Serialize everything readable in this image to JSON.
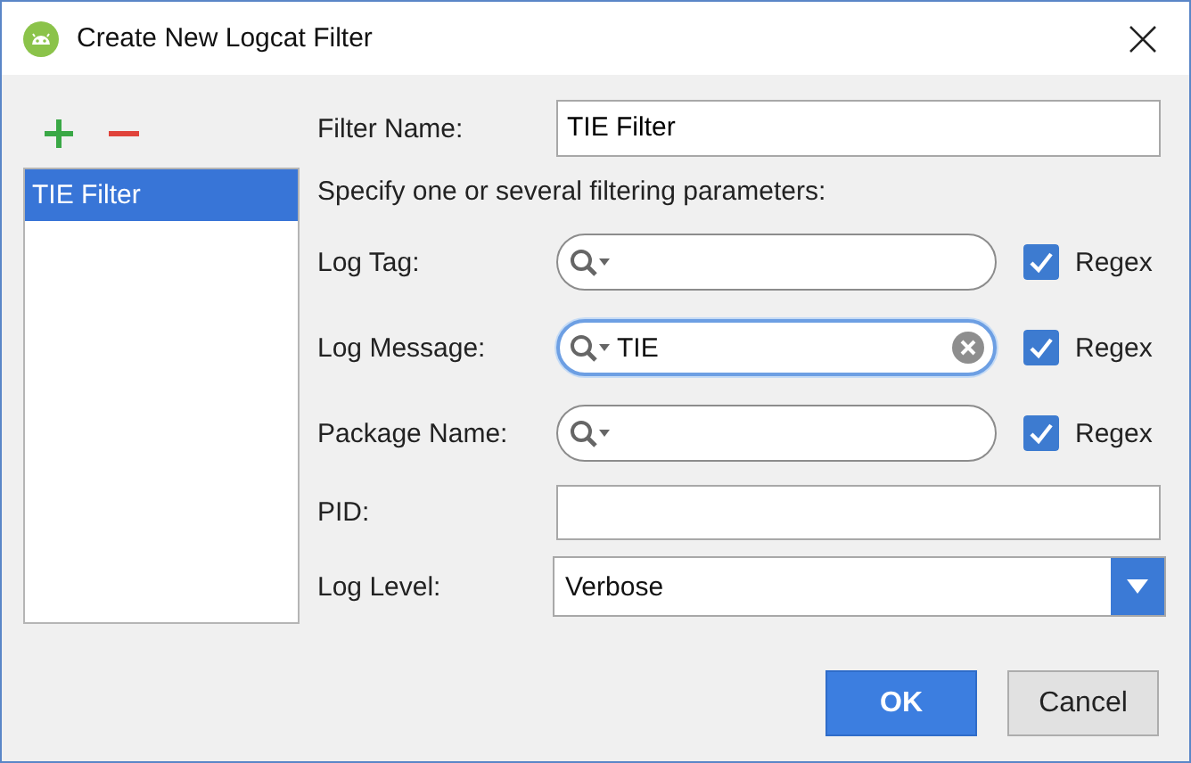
{
  "window": {
    "title": "Create New Logcat Filter"
  },
  "filters": [
    {
      "label": "TIE Filter",
      "selected": true
    }
  ],
  "filter_name": {
    "label": "Filter Name:",
    "value": "TIE Filter"
  },
  "hint": "Specify one or several filtering parameters:",
  "parameters": [
    {
      "kind": "search",
      "label": "Log Tag:",
      "focused": false,
      "regex": {
        "label": "Regex",
        "checked": true
      }
    },
    {
      "kind": "search",
      "label": "Log Message:",
      "value": "TIE",
      "focused": true,
      "regex": {
        "label": "Regex",
        "checked": true
      }
    },
    {
      "kind": "search",
      "label": "Package Name:",
      "focused": false,
      "regex": {
        "label": "Regex",
        "checked": true
      }
    },
    {
      "kind": "text",
      "label": "PID:"
    },
    {
      "kind": "dropdown",
      "label": "Log Level:",
      "value": "Verbose"
    }
  ],
  "buttons": [
    {
      "label": "OK",
      "default": true
    },
    {
      "label": "Cancel",
      "default": false
    }
  ]
}
